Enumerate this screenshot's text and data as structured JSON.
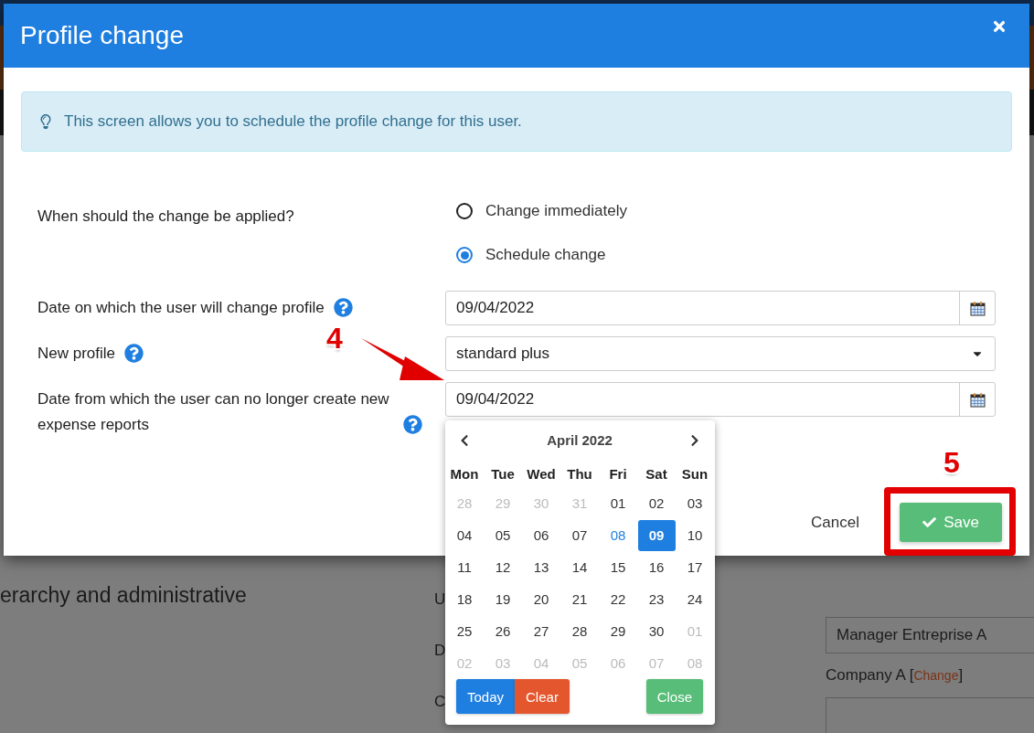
{
  "background": {
    "heading": "erarchy and administrative",
    "labels": [
      "U",
      "D",
      "C"
    ],
    "manager_field": {
      "value": "Manager Entreprise A"
    },
    "company_line": {
      "before": "Company A [",
      "link": "Change",
      "after": "]"
    }
  },
  "dialog": {
    "title": "Profile change",
    "info": "This screen allows you to schedule the profile change for this user.",
    "question": {
      "label": "When should the change be applied?",
      "options": [
        {
          "label": "Change immediately",
          "selected": false
        },
        {
          "label": "Schedule change",
          "selected": true
        }
      ]
    },
    "fields": [
      {
        "label": "Date on which the user will change profile",
        "kind": "date",
        "value": "09/04/2022"
      },
      {
        "label": "New profile",
        "kind": "select",
        "value": "standard plus"
      },
      {
        "label": "Date from which the user can no longer create new expense reports",
        "kind": "date",
        "value": "09/04/2022"
      }
    ],
    "footer": {
      "cancel": "Cancel",
      "save": "Save"
    }
  },
  "calendar": {
    "month": "April 2022",
    "weekdays": [
      "Mon",
      "Tue",
      "Wed",
      "Thu",
      "Fri",
      "Sat",
      "Sun"
    ],
    "days": [
      {
        "label": "28",
        "outside": true,
        "today": false,
        "selected": false
      },
      {
        "label": "29",
        "outside": true,
        "today": false,
        "selected": false
      },
      {
        "label": "30",
        "outside": true,
        "today": false,
        "selected": false
      },
      {
        "label": "31",
        "outside": true,
        "today": false,
        "selected": false
      },
      {
        "label": "01",
        "outside": false,
        "today": false,
        "selected": false
      },
      {
        "label": "02",
        "outside": false,
        "today": false,
        "selected": false
      },
      {
        "label": "03",
        "outside": false,
        "today": false,
        "selected": false
      },
      {
        "label": "04",
        "outside": false,
        "today": false,
        "selected": false
      },
      {
        "label": "05",
        "outside": false,
        "today": false,
        "selected": false
      },
      {
        "label": "06",
        "outside": false,
        "today": false,
        "selected": false
      },
      {
        "label": "07",
        "outside": false,
        "today": false,
        "selected": false
      },
      {
        "label": "08",
        "outside": false,
        "today": true,
        "selected": false
      },
      {
        "label": "09",
        "outside": false,
        "today": false,
        "selected": true
      },
      {
        "label": "10",
        "outside": false,
        "today": false,
        "selected": false
      },
      {
        "label": "11",
        "outside": false,
        "today": false,
        "selected": false
      },
      {
        "label": "12",
        "outside": false,
        "today": false,
        "selected": false
      },
      {
        "label": "13",
        "outside": false,
        "today": false,
        "selected": false
      },
      {
        "label": "14",
        "outside": false,
        "today": false,
        "selected": false
      },
      {
        "label": "15",
        "outside": false,
        "today": false,
        "selected": false
      },
      {
        "label": "16",
        "outside": false,
        "today": false,
        "selected": false
      },
      {
        "label": "17",
        "outside": false,
        "today": false,
        "selected": false
      },
      {
        "label": "18",
        "outside": false,
        "today": false,
        "selected": false
      },
      {
        "label": "19",
        "outside": false,
        "today": false,
        "selected": false
      },
      {
        "label": "20",
        "outside": false,
        "today": false,
        "selected": false
      },
      {
        "label": "21",
        "outside": false,
        "today": false,
        "selected": false
      },
      {
        "label": "22",
        "outside": false,
        "today": false,
        "selected": false
      },
      {
        "label": "23",
        "outside": false,
        "today": false,
        "selected": false
      },
      {
        "label": "24",
        "outside": false,
        "today": false,
        "selected": false
      },
      {
        "label": "25",
        "outside": false,
        "today": false,
        "selected": false
      },
      {
        "label": "26",
        "outside": false,
        "today": false,
        "selected": false
      },
      {
        "label": "27",
        "outside": false,
        "today": false,
        "selected": false
      },
      {
        "label": "28",
        "outside": false,
        "today": false,
        "selected": false
      },
      {
        "label": "29",
        "outside": false,
        "today": false,
        "selected": false
      },
      {
        "label": "30",
        "outside": false,
        "today": false,
        "selected": false
      },
      {
        "label": "01",
        "outside": true,
        "today": false,
        "selected": false
      },
      {
        "label": "02",
        "outside": true,
        "today": false,
        "selected": false
      },
      {
        "label": "03",
        "outside": true,
        "today": false,
        "selected": false
      },
      {
        "label": "04",
        "outside": true,
        "today": false,
        "selected": false
      },
      {
        "label": "05",
        "outside": true,
        "today": false,
        "selected": false
      },
      {
        "label": "06",
        "outside": true,
        "today": false,
        "selected": false
      },
      {
        "label": "07",
        "outside": true,
        "today": false,
        "selected": false
      },
      {
        "label": "08",
        "outside": true,
        "today": false,
        "selected": false
      }
    ],
    "buttons": {
      "today": "Today",
      "clear": "Clear",
      "close": "Close"
    }
  },
  "annotations": [
    {
      "label": "4",
      "kind": "arrow"
    },
    {
      "label": "5",
      "kind": "frame"
    }
  ]
}
